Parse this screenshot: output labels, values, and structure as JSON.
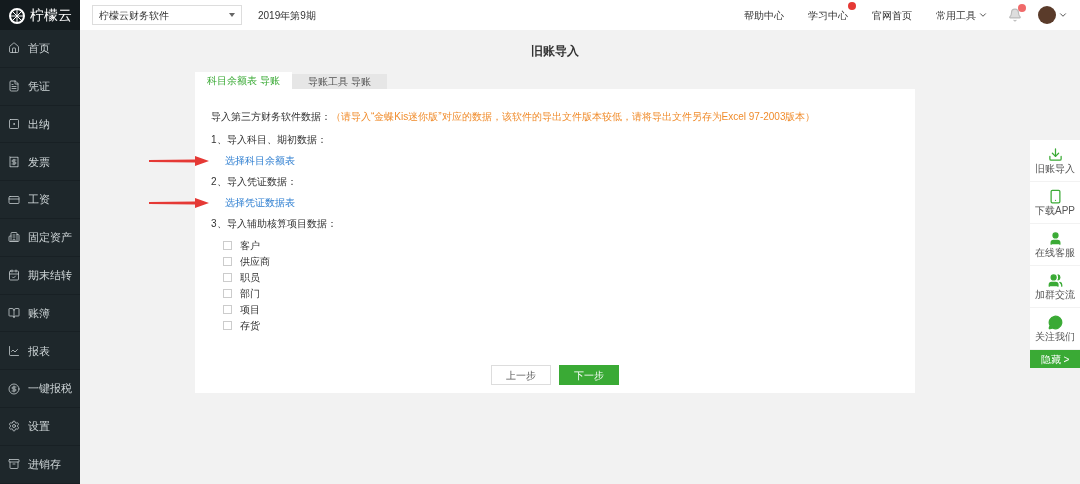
{
  "brand": {
    "name": "柠檬云"
  },
  "topbar": {
    "company_select": "柠檬云财务软件",
    "period": "2019年第9期",
    "links": [
      {
        "label": "帮助中心",
        "badge": false,
        "dropdown": false
      },
      {
        "label": "学习中心",
        "badge": true,
        "dropdown": false
      },
      {
        "label": "官网首页",
        "badge": false,
        "dropdown": false
      },
      {
        "label": "常用工具",
        "badge": false,
        "dropdown": true
      }
    ],
    "notification_badge": true
  },
  "sidebar": {
    "items": [
      {
        "label": "首页"
      },
      {
        "label": "凭证"
      },
      {
        "label": "出纳"
      },
      {
        "label": "发票"
      },
      {
        "label": "工资"
      },
      {
        "label": "固定资产"
      },
      {
        "label": "期末结转"
      },
      {
        "label": "账簿"
      },
      {
        "label": "报表"
      },
      {
        "label": "一键报税"
      },
      {
        "label": "设置"
      },
      {
        "label": "进销存"
      }
    ]
  },
  "page": {
    "title": "旧账导入",
    "tabs": [
      {
        "label": "科目余额表 导账",
        "selected": true
      },
      {
        "label": "导账工具 导账",
        "selected": false
      }
    ],
    "intro_label": "导入第三方财务软件数据：",
    "intro_note": "（请导入“金蝶Kis迷你版”对应的数据，该软件的导出文件版本较低，请将导出文件另存为Excel 97-2003版本）",
    "steps": [
      {
        "label": "1、导入科目、期初数据：",
        "link": "选择科目余额表",
        "arrow": true
      },
      {
        "label": "2、导入凭证数据：",
        "link": "选择凭证数据表",
        "arrow": true
      },
      {
        "label": "3、导入辅助核算项目数据：",
        "options": [
          {
            "label": "客户",
            "checked": false
          },
          {
            "label": "供应商",
            "checked": false
          },
          {
            "label": "职员",
            "checked": false
          },
          {
            "label": "部门",
            "checked": false
          },
          {
            "label": "项目",
            "checked": false
          },
          {
            "label": "存货",
            "checked": false
          }
        ]
      }
    ],
    "buttons": [
      {
        "label": "上一步",
        "kind": "secondary"
      },
      {
        "label": "下一步",
        "kind": "primary"
      }
    ]
  },
  "float_panel": {
    "items": [
      {
        "label": "旧账导入"
      },
      {
        "label": "下载APP"
      },
      {
        "label": "在线客服"
      },
      {
        "label": "加群交流"
      },
      {
        "label": "关注我们"
      }
    ],
    "hide_button": "隐藏 >"
  }
}
